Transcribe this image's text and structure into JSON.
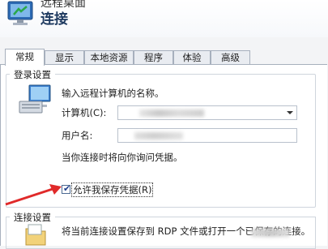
{
  "header": {
    "app_title": "远程桌面",
    "connection_title": "连接"
  },
  "tabs": [
    {
      "label": "常规",
      "active": true
    },
    {
      "label": "显示",
      "active": false
    },
    {
      "label": "本地资源",
      "active": false
    },
    {
      "label": "程序",
      "active": false
    },
    {
      "label": "体验",
      "active": false
    },
    {
      "label": "高级",
      "active": false
    }
  ],
  "login": {
    "group_title": "登录设置",
    "prompt": "输入远程计算机的名称。",
    "computer_label": "计算机(C):",
    "username_label": "用户名:",
    "credential_note": "当你连接时将向你询问凭据。",
    "allow_save_label": "允许我保存凭据(R)",
    "allow_save_checked": true
  },
  "connection": {
    "group_title": "连接设置",
    "description": "将当前连接设置保存到 RDP 文件或打开一个已保存的连接。"
  },
  "colors": {
    "tab_border": "#a7b0bd",
    "annotation_arrow": "#e02a2a",
    "checkbox_mark": "#1e3e8c"
  }
}
